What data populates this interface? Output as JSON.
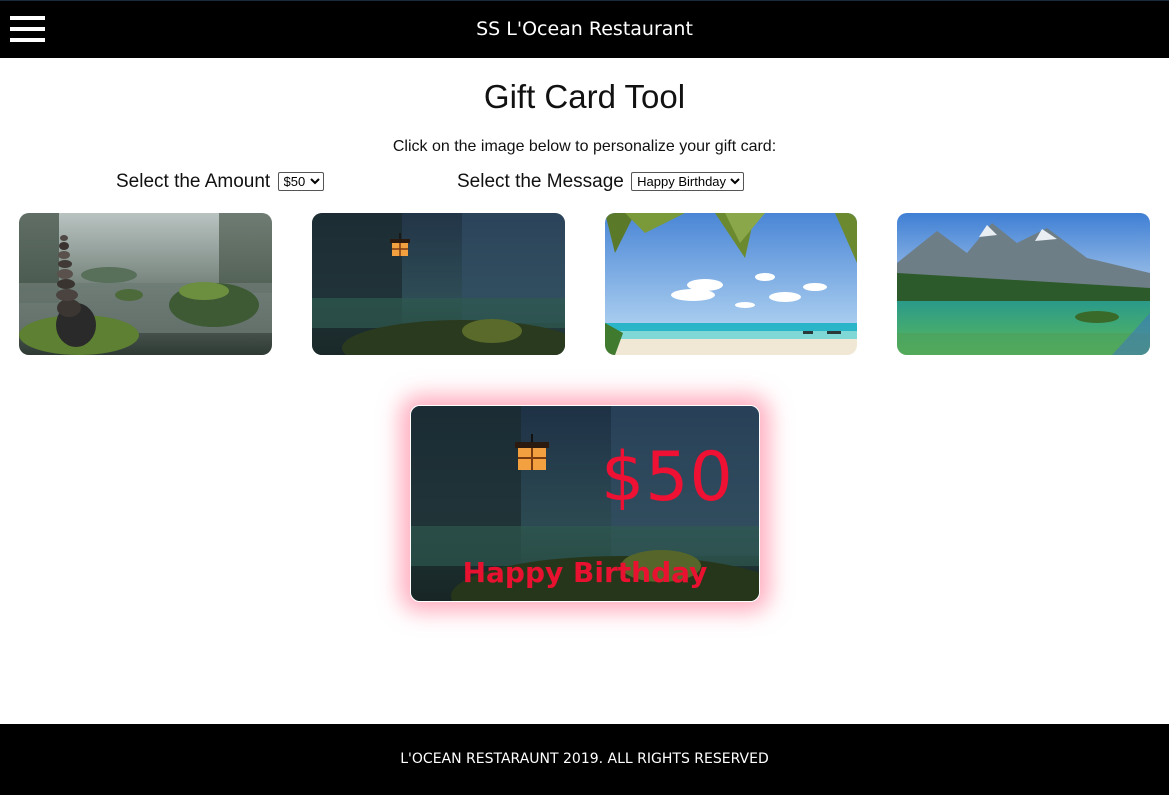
{
  "header": {
    "menu_icon": "hamburger-menu-icon",
    "title": "SS L'Ocean Restaurant"
  },
  "main": {
    "title": "Gift Card Tool",
    "instructions": "Click on the image below to personalize your gift card:",
    "amount_label": "Select the Amount",
    "amount_selected": "$50",
    "message_label": "Select the Message",
    "message_selected": "Happy Birthday",
    "thumbnails": [
      {
        "name": "zen-stones-stream"
      },
      {
        "name": "forest-lantern"
      },
      {
        "name": "tropical-beach"
      },
      {
        "name": "mountain-lake"
      }
    ]
  },
  "card": {
    "amount": "$50",
    "message": "Happy Birthday",
    "text_color": "#ee1133",
    "glow_color": "#ff6e8c"
  },
  "footer": {
    "text": "L'OCEAN RESTARAUNT 2019. ALL RIGHTS RESERVED"
  }
}
